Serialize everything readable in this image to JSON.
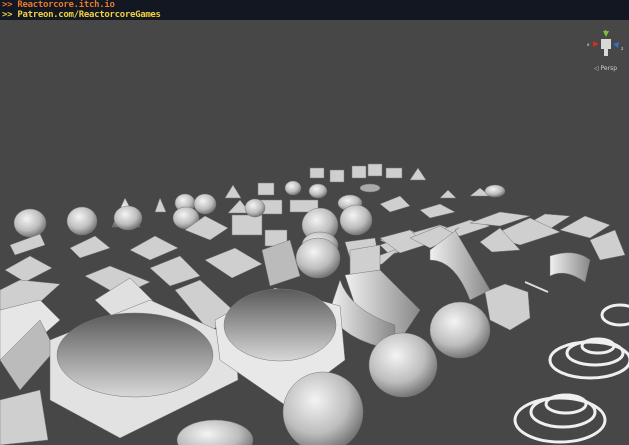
{
  "overlay": {
    "line1": ">> Reactorcore.itch.io",
    "line2": ">> Patreon.com/ReactorcoreGames"
  },
  "scene_gizmo": {
    "x_label": "x",
    "y_label": "y",
    "z_label": "z",
    "projection_label": "◁ Persp",
    "colors": {
      "x": "#d03020",
      "y": "#80c030",
      "z": "#3070d0"
    }
  }
}
